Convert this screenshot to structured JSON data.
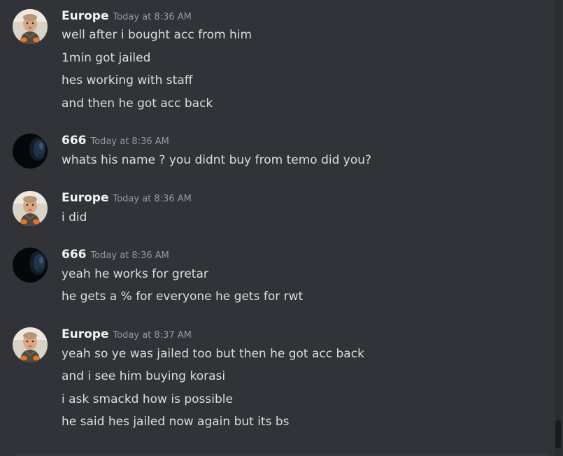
{
  "messages": [
    {
      "user": "Europe",
      "time": "Today at 8:36 AM",
      "avatar": "baby-photo-avatar",
      "lines": [
        "well after i bought acc from him",
        "1min got jailed",
        "hes working with staff",
        "and then he got acc back"
      ]
    },
    {
      "user": "666",
      "time": "Today at 8:36 AM",
      "avatar": "dark-face-avatar",
      "lines": [
        "whats his name ? you didnt buy from temo did you?"
      ]
    },
    {
      "user": "Europe",
      "time": "Today at 8:36 AM",
      "avatar": "baby-photo-avatar",
      "lines": [
        "i did"
      ]
    },
    {
      "user": "666",
      "time": "Today at 8:36 AM",
      "avatar": "dark-face-avatar",
      "lines": [
        "yeah he works for gretar",
        "he gets a % for everyone he gets for rwt"
      ]
    },
    {
      "user": "Europe",
      "time": "Today at 8:37 AM",
      "avatar": "baby-photo-avatar",
      "lines": [
        "yeah so ye was jailed too but then he got acc back",
        "and i see him buying korasi",
        "i ask smackd how is possible",
        "he said hes jailed now again but its bs"
      ]
    }
  ],
  "colors": {
    "background": "#313338",
    "username": "#f2f3f5",
    "timestamp": "#949ba4",
    "message_text": "#dbdee1"
  }
}
